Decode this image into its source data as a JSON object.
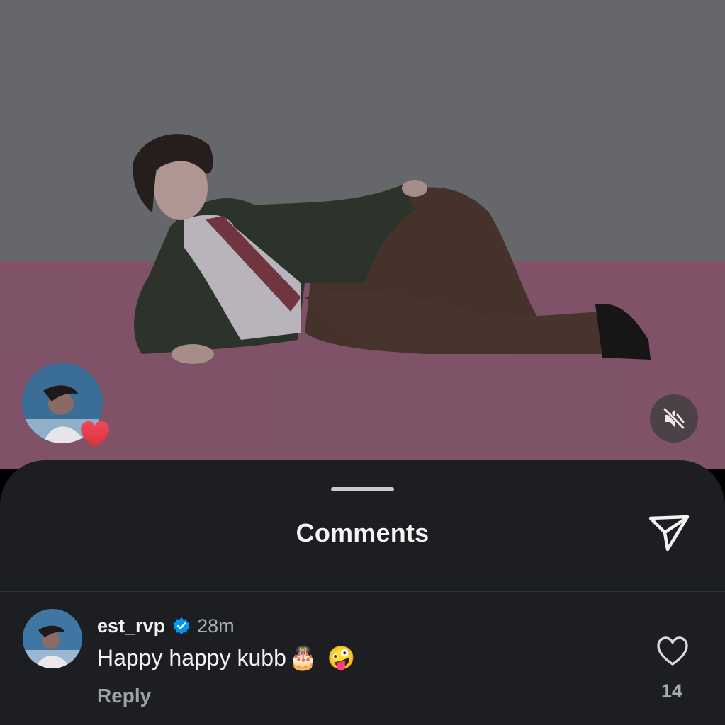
{
  "media": {
    "story_avatar_icon": "user-story-avatar",
    "reaction_icon": "heart-emoji",
    "mute_icon": "speaker-muted-icon"
  },
  "sheet": {
    "title": "Comments",
    "share_icon": "paper-plane-icon"
  },
  "comments": [
    {
      "username": "est_rvp",
      "verified": true,
      "time": "28m",
      "text": "Happy happy kubb",
      "emojis": [
        "🎂",
        "🤪"
      ],
      "reply_label": "Reply",
      "likes": "14",
      "like_icon": "heart-outline-icon"
    }
  ],
  "colors": {
    "sheet_bg": "#1c1e21",
    "verified_blue": "#0095f6",
    "text_primary": "#f2f2f2",
    "text_secondary": "#a8abb0"
  }
}
